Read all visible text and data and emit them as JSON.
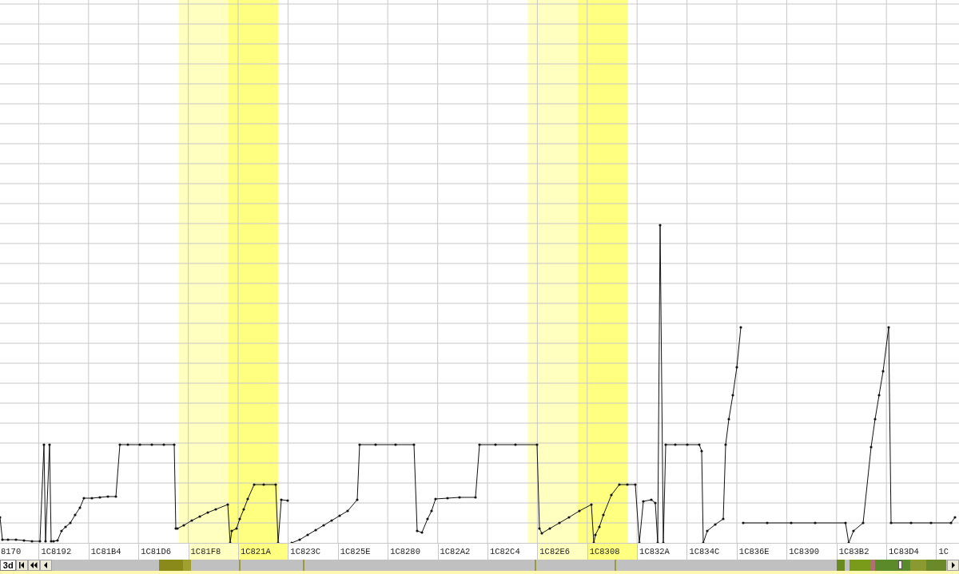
{
  "chart": {
    "x_labels": [
      {
        "text": "8170",
        "highlighted": false
      },
      {
        "text": "1C8192",
        "highlighted": false
      },
      {
        "text": "1C81B4",
        "highlighted": false
      },
      {
        "text": "1C81D6",
        "highlighted": false
      },
      {
        "text": "1C81F8",
        "highlighted": true,
        "color": "#ffffc0"
      },
      {
        "text": "1C821A",
        "highlighted": true,
        "color": "#ffff80"
      },
      {
        "text": "1C823C",
        "highlighted": false
      },
      {
        "text": "1C825E",
        "highlighted": false
      },
      {
        "text": "1C8280",
        "highlighted": false
      },
      {
        "text": "1C82A2",
        "highlighted": false
      },
      {
        "text": "1C82C4",
        "highlighted": false
      },
      {
        "text": "1C82E6",
        "highlighted": true,
        "color": "#ffffc0"
      },
      {
        "text": "1C8308",
        "highlighted": true,
        "color": "#ffff80"
      },
      {
        "text": "1C832A",
        "highlighted": false
      },
      {
        "text": "1C834C",
        "highlighted": false
      },
      {
        "text": "1C836E",
        "highlighted": false
      },
      {
        "text": "1C8390",
        "highlighted": false
      },
      {
        "text": "1C83B2",
        "highlighted": false
      },
      {
        "text": "1C83D4",
        "highlighted": false
      },
      {
        "text": "1C",
        "highlighted": false
      }
    ]
  },
  "sheet_tab": {
    "label": "3d",
    "selected": true
  }
}
